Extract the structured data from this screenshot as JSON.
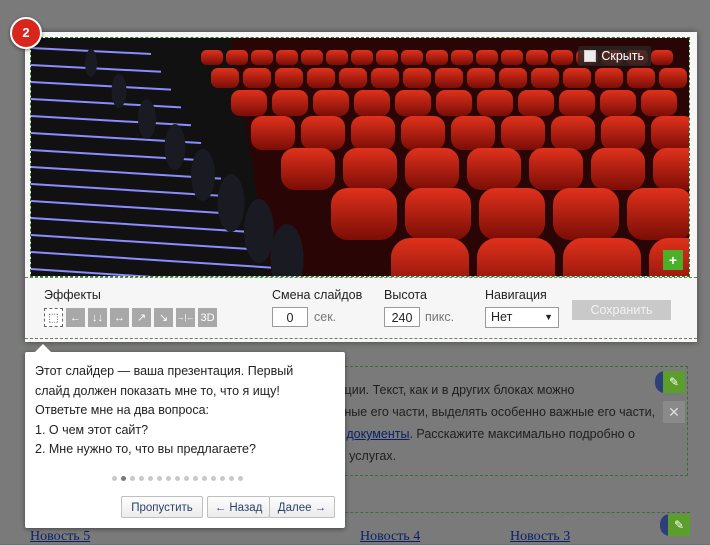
{
  "badge": "2",
  "slider": {
    "hide_label": "Скрыть",
    "add_label": "+",
    "effects_label": "Эффекты",
    "effects": [
      {
        "name": "crossfade",
        "glyph": "⬚"
      },
      {
        "name": "left",
        "glyph": "←"
      },
      {
        "name": "down",
        "glyph": "↓↓"
      },
      {
        "name": "split-h",
        "glyph": "↔"
      },
      {
        "name": "diag-up",
        "glyph": "↗"
      },
      {
        "name": "diag-down",
        "glyph": "↘"
      },
      {
        "name": "split-in",
        "glyph": "→|←"
      },
      {
        "name": "3d",
        "glyph": "3D"
      }
    ],
    "interval_label": "Смена слайдов",
    "interval_value": "0",
    "interval_unit": "сек.",
    "height_label": "Высота",
    "height_value": "240",
    "height_unit": "пикс.",
    "nav_label": "Навигация",
    "nav_value": "Нет",
    "save_label": "Сохранить"
  },
  "tooltip": {
    "lines": [
      "Этот слайдер — ваша презентация. Первый",
      "слайд должен показать мне то, что я ищу!",
      "Ответьте мне на два вопроса:",
      "1. О чем этот сайт?",
      "2. Мне нужно то, что вы предлагаете?"
    ],
    "dots_total": 15,
    "dots_active": 2,
    "skip_label": "Пропустить",
    "back_label": "← Назад",
    "next_label": "Далее →"
  },
  "background": {
    "text_lines": [
      "мации. Текст, как и в других блоках можно",
      "ажные его части, выделять особенно важные его части,",
      "на ",
      "с и услугах."
    ],
    "link_text": "документы",
    "line3_after": ". Расскажите максимально подробно о",
    "news": [
      "Новость 5",
      "Новость 4",
      "Новость 3"
    ]
  }
}
